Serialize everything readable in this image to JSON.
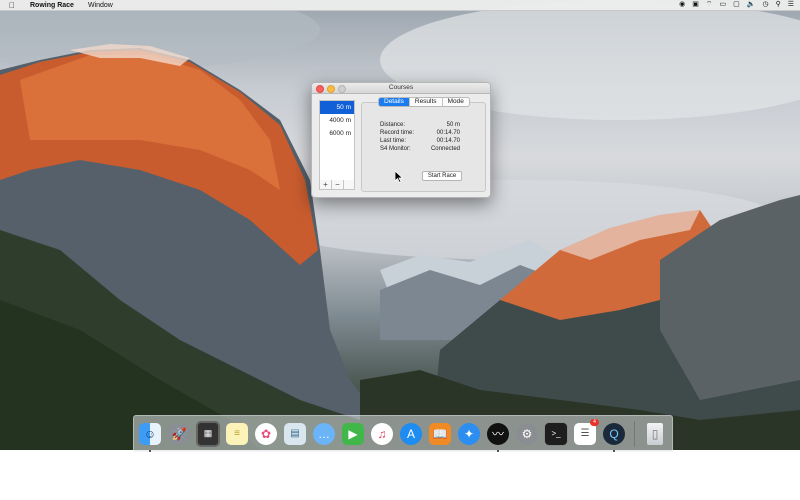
{
  "menubar": {
    "app_name": "Rowing Race",
    "menus": [
      "Window"
    ],
    "status_icons": [
      "record-icon",
      "notification-icon",
      "wifi-icon",
      "battery-icon",
      "screen-icon",
      "volume-icon",
      "clock-icon",
      "search-icon",
      "list-icon"
    ]
  },
  "window": {
    "title": "Courses",
    "courses": [
      "50 m",
      "4000 m",
      "6000 m"
    ],
    "selected_course": "50 m",
    "add_label": "+",
    "remove_label": "−",
    "tabs": [
      "Details",
      "Results",
      "Mode"
    ],
    "active_tab": "Details",
    "details": {
      "distance_label": "Distance:",
      "distance_value": "50 m",
      "record_label": "Record time:",
      "record_value": "00:14.70",
      "last_label": "Last time:",
      "last_value": "00:14.70",
      "monitor_label": "S4 Monitor:",
      "monitor_value": "Connected"
    },
    "start_button": "Start Race"
  },
  "dock": {
    "items": [
      {
        "name": "finder-icon",
        "running": true
      },
      {
        "name": "launchpad-icon",
        "running": false
      },
      {
        "name": "mission-control-icon",
        "running": false
      },
      {
        "name": "notes-icon",
        "running": false
      },
      {
        "name": "photos-icon",
        "running": false
      },
      {
        "name": "preview-icon",
        "running": false
      },
      {
        "name": "messages-icon",
        "running": false
      },
      {
        "name": "facetime-icon",
        "running": false
      },
      {
        "name": "itunes-icon",
        "running": false
      },
      {
        "name": "app-store-icon",
        "running": false
      },
      {
        "name": "ibooks-icon",
        "running": false
      },
      {
        "name": "safari-icon",
        "running": false
      },
      {
        "name": "rowing-race-icon",
        "running": true
      },
      {
        "name": "system-preferences-icon",
        "running": false
      },
      {
        "name": "terminal-icon",
        "running": false
      },
      {
        "name": "reminders-icon",
        "running": false,
        "badge": "4"
      },
      {
        "name": "quicktime-icon",
        "running": true
      },
      {
        "name": "trash-icon",
        "running": false
      }
    ]
  }
}
